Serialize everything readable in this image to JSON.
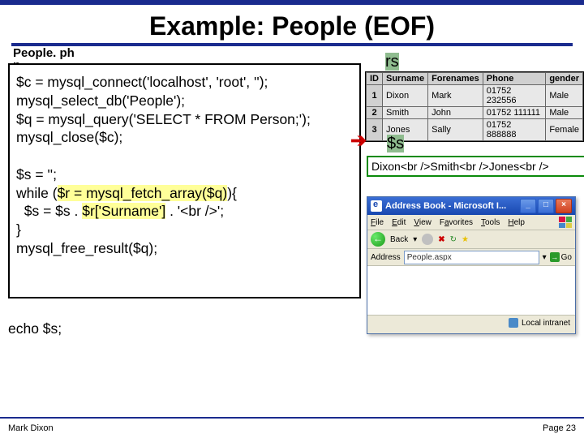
{
  "title": "Example: People (EOF)",
  "file_label": "People. ph\np",
  "code": {
    "l1a": "$c = mysql_connect('localhost', 'root', '');",
    "l2": "mysql_select_db('People');",
    "l3a": "$q = mysql_query('SELECT * FROM Person;');",
    "l4": "mysql_close($c);",
    "l5": "$s = '';",
    "l6a": "while (",
    "l6b": "$r = mysql_fetch_array($q)",
    "l6c": "){",
    "l7a": "  $s = $s . ",
    "l7b": "$r['Surname']",
    "l7c": " . '<br />';",
    "l8": "}",
    "l9": "mysql_free_result($q);",
    "echo": "echo $s;"
  },
  "rs_label": "rs",
  "table": {
    "headers": [
      "ID",
      "Surname",
      "Forenames",
      "Phone",
      "gender"
    ],
    "rows": [
      [
        "1",
        "Dixon",
        "Mark",
        "01752 232556",
        "Male"
      ],
      [
        "2",
        "Smith",
        "John",
        "01752 111111",
        "Male"
      ],
      [
        "3",
        "Jones",
        "Sally",
        "01752 888888",
        "Female"
      ]
    ]
  },
  "s_label": "$s",
  "s_content": "Dixon<br />Smith<br />Jones<br />",
  "browser": {
    "title": "Address Book - Microsoft I...",
    "menu": [
      "File",
      "Edit",
      "View",
      "Favorites",
      "Tools",
      "Help"
    ],
    "back": "Back",
    "address_label": "Address",
    "address_value": "People.aspx",
    "go": "Go",
    "status": "Local intranet"
  },
  "footer": {
    "author": "Mark Dixon",
    "page": "Page 23"
  }
}
